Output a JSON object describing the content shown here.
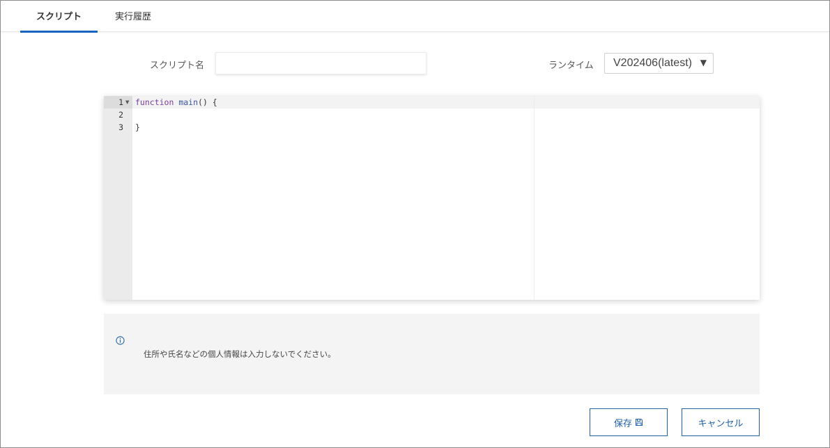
{
  "tabs": {
    "script_label": "スクリプト",
    "history_label": "実行履歴"
  },
  "form": {
    "script_name_label": "スクリプト名",
    "script_name_value": "",
    "runtime_label": "ランタイム",
    "runtime_value": "V202406(latest)"
  },
  "editor": {
    "line_numbers": [
      "1",
      "2",
      "3"
    ],
    "lines": [
      {
        "keyword": "function",
        "name": "main",
        "rest": "() {"
      },
      {
        "text": ""
      },
      {
        "text": "}"
      }
    ]
  },
  "notice": {
    "text": "住所や氏名などの個人情報は入力しないでください。"
  },
  "buttons": {
    "save_label": "保存",
    "cancel_label": "キャンセル"
  },
  "colors": {
    "accent": "#1565c0",
    "button_border": "#1f5fa8",
    "notice_bg": "#f4f4f4"
  },
  "icons": {
    "info": "info-circle-icon",
    "save": "floppy-disk-icon",
    "dropdown": "caret-down-icon",
    "fold": "fold-arrow-icon"
  }
}
